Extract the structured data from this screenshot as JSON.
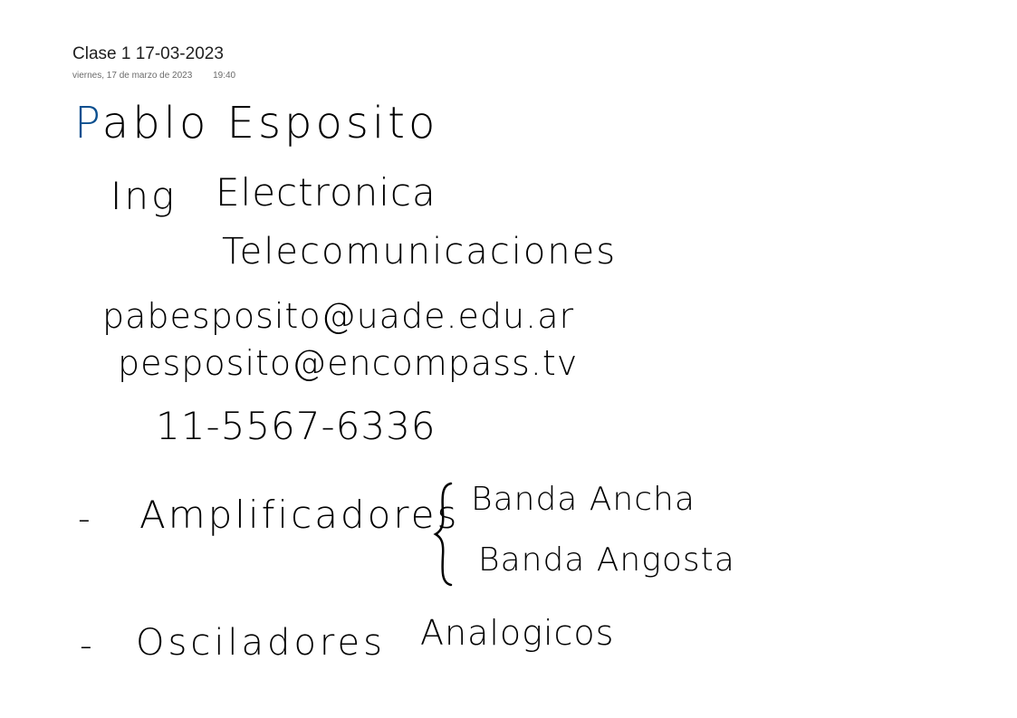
{
  "note": {
    "title": "Clase 1 17-03-2023",
    "date": "viernes, 17 de marzo de 2023",
    "time": "19:40"
  },
  "handwriting": {
    "name_first_letter": "P",
    "name_rest": "ablo Esposito",
    "ing": "Ing",
    "electronica": "Electronica",
    "telecomunicaciones": "Telecomunicaciones",
    "email1": "pabesposito@uade.edu.ar",
    "email2": "pesposito@encompass.tv",
    "phone": "11-5567-6336",
    "dash1": "-",
    "amplificadores": "Amplificadores",
    "banda_ancha": "Banda Ancha",
    "banda_angosta": "Banda Angosta",
    "dash2": "-",
    "osciladores": "Osciladores",
    "analogicos": "Analogicos"
  },
  "colors": {
    "ink": "#000000",
    "accent_ink": "#0b4f8f",
    "meta_text": "#6b6b6b"
  }
}
